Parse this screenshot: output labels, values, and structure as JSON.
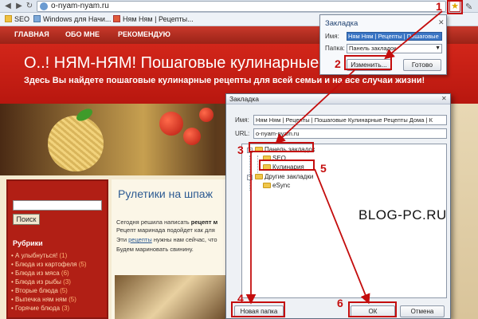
{
  "browser": {
    "url": "o-nyam-nyam.ru",
    "bookmarks": [
      "SEO",
      "Windows для Начи...",
      "Ням Ням | Рецепты..."
    ]
  },
  "site": {
    "nav": [
      "ГЛАВНАЯ",
      "ОБО МНЕ",
      "РЕКОМЕНДУЮ"
    ],
    "title": "О..! НЯМ-НЯМ! Пошаговые кулинарные рецепты",
    "subtitle": "Здесь Вы найдете пошаговые кулинарные рецепты для всей семьи и на все случаи жизни!",
    "search_button": "Поиск",
    "rubrics_title": "Рубрики",
    "rubrics": [
      {
        "label": "А улыбнуться!",
        "count": "(1)"
      },
      {
        "label": "Блюда из картофеля",
        "count": "(5)"
      },
      {
        "label": "Блюда из мяса",
        "count": "(6)"
      },
      {
        "label": "Блюда из рыбы",
        "count": "(3)"
      },
      {
        "label": "Вторые блюда",
        "count": "(5)"
      },
      {
        "label": "Выпечка ням ням",
        "count": "(5)"
      },
      {
        "label": "Горячие блюда",
        "count": "(3)"
      }
    ],
    "post_title": "Рулетики на шпаж",
    "post_lines": [
      "Сегодня решила написать",
      "рецепт м",
      "Рецепт маринада подойдет как для",
      "Эти",
      "рецепты",
      "нужны нам сейчас, что",
      "Будем мариновать свинину."
    ]
  },
  "popup": {
    "title": "Закладка",
    "name_label": "Имя:",
    "name_value": "Ням Ням | Рецепты | Пошаговые",
    "folder_label": "Папка:",
    "folder_value": "Панель закладок",
    "edit_button": "Изменить...",
    "done_button": "Готово"
  },
  "dialog": {
    "title": "Закладка",
    "name_label": "Имя:",
    "name_value": "Ням Ням | Рецепты | Пошаговые Кулинарные Рецепты Дома | К",
    "url_label": "URL:",
    "url_value": "o-nyam-nyam.ru",
    "tree": [
      "Панель закладок",
      "SEO",
      "Кулинария",
      "Другие закладки",
      "eSync"
    ],
    "new_folder_button": "Новая папка",
    "ok_button": "ОК",
    "cancel_button": "Отмена"
  },
  "annotations": {
    "steps": [
      "1",
      "2",
      "3",
      "4",
      "5",
      "6"
    ],
    "watermark": "BLOG-PC.RU",
    "color": "#c40d0d"
  }
}
